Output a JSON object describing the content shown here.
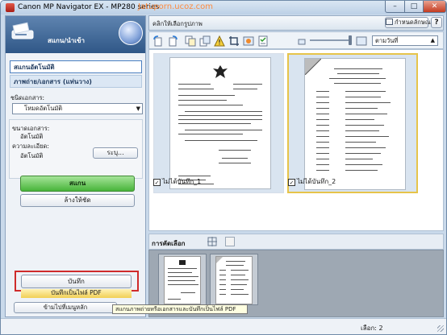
{
  "window": {
    "title": "Canon MP Navigator EX - MP280 series",
    "watermark": "Jatuporn.ucoz.com",
    "min_glyph": "–",
    "max_glyph": "□",
    "close_glyph": "✕"
  },
  "left_panel": {
    "nav_title": "สแกน/นำเข้า",
    "modes": [
      {
        "label": "สแกนอัตโนมัติ"
      },
      {
        "label": "ภาพถ่าย/เอกสาร (แท่นวาง)"
      }
    ],
    "doc_type_label": "ชนิดเอกสาร:",
    "doc_type_value": "โหมดอัตโนมัติ",
    "doc_size_label": "ขนาดเอกสาร:",
    "doc_size_value": "อัตโนมัติ",
    "resolution_label": "ความละเอียด:",
    "resolution_value": "อัตโนมัติ",
    "settings_button": "ระบุ...",
    "scan_button": "สแกน",
    "clear_button": "ล้างให้ชัด",
    "save_button": "บันทึก",
    "save_pdf_button": "บันทึกเป็นไฟล์ PDF",
    "jump_button": "ข้ามไปที่เมนูหลัก"
  },
  "workspace": {
    "title": "คลิกให้เลือกรูปภาพ",
    "preferences_button": "กำหนดลักษณะ",
    "help_button": "?",
    "sort_value": "ตามวันที่",
    "thumbnails": [
      {
        "label": "ไม่ได้บันทึก_1",
        "checked": true
      },
      {
        "label": "ไม่ได้บันทึก_2",
        "checked": true,
        "selected": true
      }
    ],
    "check_glyph": "✓"
  },
  "selection": {
    "label": "การคัดเลือก",
    "count": 2
  },
  "tooltip": "สแกนภาพถ่ายหรือเอกสารและบันทึกเป็นไฟล์ PDF",
  "status": {
    "selected": "เลือก: 2"
  },
  "colors": {
    "scan_button": "#48b43a",
    "save_highlight": "#cf2b2b",
    "selected_border": "#e6c44a"
  }
}
